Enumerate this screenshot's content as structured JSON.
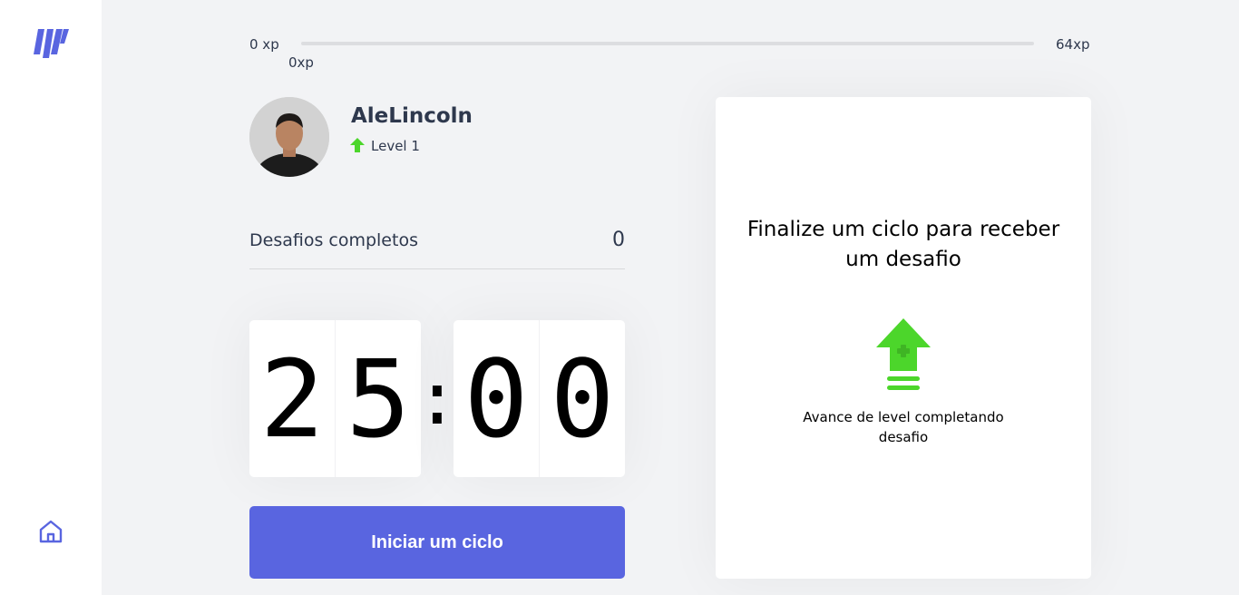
{
  "sidebar": {
    "logo_icon": "moveit-logo-icon",
    "home_icon": "home-icon",
    "accent": "#5965e0"
  },
  "xp": {
    "start_label": "0 xp",
    "current_label": "0xp",
    "end_label": "64xp",
    "progress": 0
  },
  "profile": {
    "name": "AleLincoln",
    "level_label": "Level 1",
    "level_icon": "level-up-arrow-icon"
  },
  "completed": {
    "label": "Desafios completos",
    "value": "0"
  },
  "countdown": {
    "minute_left": "2",
    "minute_right": "5",
    "separator": ":",
    "second_left": "0",
    "second_right": "0"
  },
  "start_button": {
    "label": "Iniciar um ciclo",
    "color": "#5965e0"
  },
  "challenge": {
    "title": "Finalize um ciclo para receber um desafio",
    "icon": "level-up-icon",
    "description": "Avance de level completando desafio",
    "accent": "#4cd62b"
  }
}
